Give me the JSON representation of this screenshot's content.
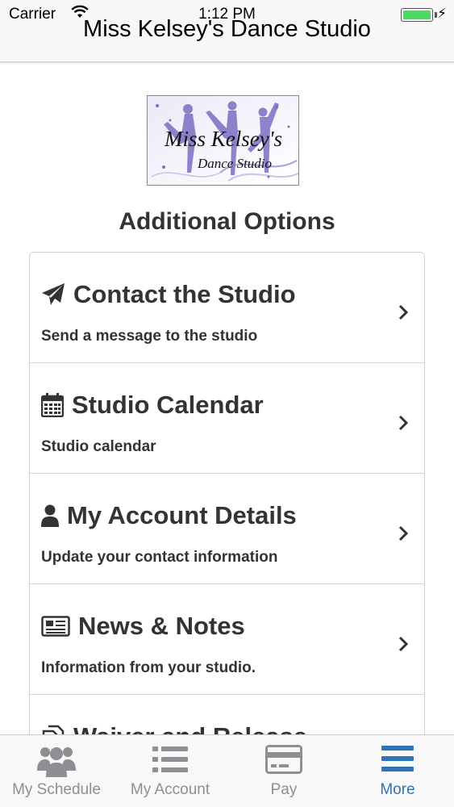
{
  "status_bar": {
    "carrier": "Carrier",
    "time": "1:12 PM",
    "battery_level": 1.0
  },
  "nav": {
    "title": "Miss Kelsey's Dance Studio"
  },
  "logo": {
    "line1": "Miss Kelsey's",
    "line2": "Dance Studio"
  },
  "main": {
    "heading": "Additional Options",
    "options": [
      {
        "icon": "paper-plane-icon",
        "title": "Contact the Studio",
        "description": "Send a message to the studio"
      },
      {
        "icon": "calendar-icon",
        "title": "Studio Calendar",
        "description": "Studio calendar"
      },
      {
        "icon": "user-icon",
        "title": "My Account Details",
        "description": "Update your contact information"
      },
      {
        "icon": "newspaper-icon",
        "title": "News & Notes",
        "description": "Information from your studio."
      },
      {
        "icon": "files-icon",
        "title": "Waiver and Release",
        "description": ""
      }
    ]
  },
  "tabbar": {
    "tabs": [
      {
        "label": "My Schedule",
        "icon": "users-icon",
        "active": false
      },
      {
        "label": "My Account",
        "icon": "list-icon",
        "active": false
      },
      {
        "label": "Pay",
        "icon": "credit-card-icon",
        "active": false
      },
      {
        "label": "More",
        "icon": "menu-icon",
        "active": true
      }
    ]
  },
  "colors": {
    "accent": "#2f73b8",
    "inactive_tab": "#8e8e93",
    "battery": "#4cd964",
    "logo_purple": "#7b6fc4"
  }
}
